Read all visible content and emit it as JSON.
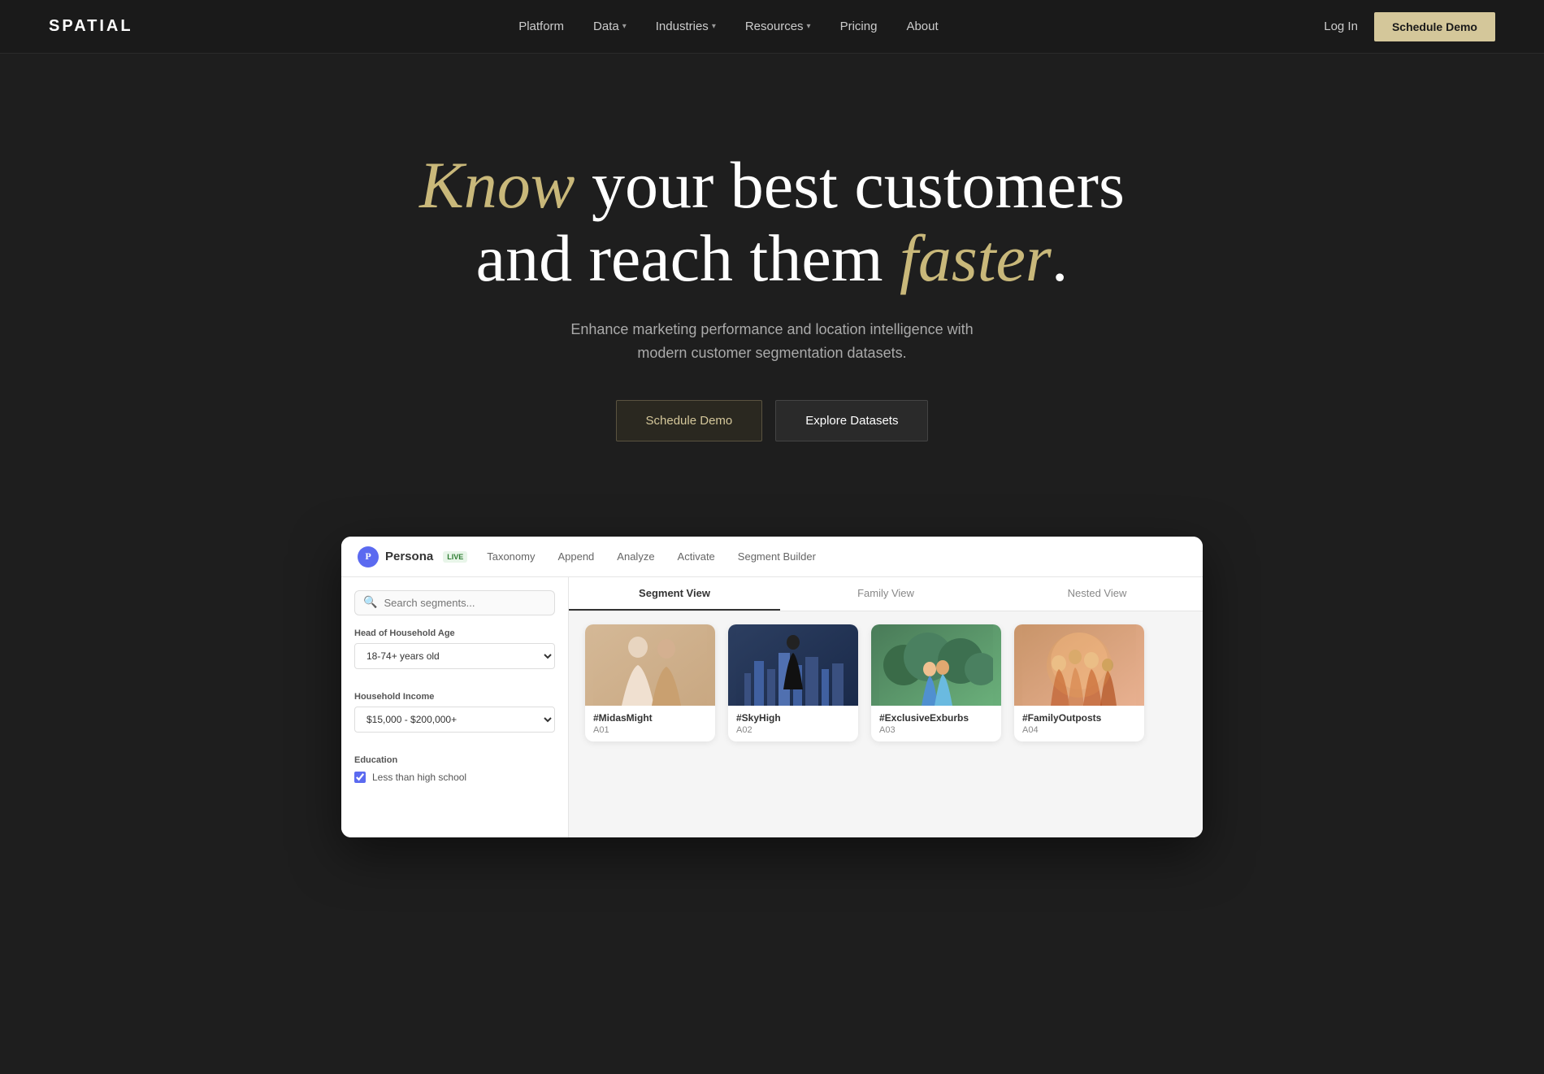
{
  "nav": {
    "logo": "SPATIAL",
    "links": [
      {
        "label": "Platform",
        "has_dropdown": false
      },
      {
        "label": "Data",
        "has_dropdown": true
      },
      {
        "label": "Industries",
        "has_dropdown": true
      },
      {
        "label": "Resources",
        "has_dropdown": true
      },
      {
        "label": "Pricing",
        "has_dropdown": false
      },
      {
        "label": "About",
        "has_dropdown": false
      }
    ],
    "login_label": "Log In",
    "cta_label": "Schedule Demo"
  },
  "hero": {
    "title_start": "your best customers",
    "title_italic_gold": "Know",
    "title_line2_start": "and reach them",
    "title_italic_white": "faster",
    "title_period": ".",
    "subtitle": "Enhance marketing performance and location intelligence with modern customer segmentation datasets.",
    "btn_schedule": "Schedule Demo",
    "btn_explore": "Explore Datasets"
  },
  "demo": {
    "nav_logo": "Persona",
    "nav_live": "LIVE",
    "nav_items": [
      "Taxonomy",
      "Append",
      "Analyze",
      "Activate",
      "Segment Builder"
    ],
    "search_placeholder": "Search segments...",
    "filter_age_label": "Head of Household Age",
    "filter_age_default": "18-74+ years old",
    "filter_income_label": "Household Income",
    "filter_income_default": "$15,000 - $200,000+",
    "filter_education_label": "Education",
    "filter_education_checkbox": "Less than high school",
    "view_tabs": [
      "Segment View",
      "Family View",
      "Nested View"
    ],
    "active_tab": 1,
    "segments": [
      {
        "tag": "#MidasMight",
        "id": "A01",
        "color_from": "#d4b896",
        "color_to": "#c9a882",
        "emoji": "👫"
      },
      {
        "tag": "#SkyHigh",
        "id": "A02",
        "color_from": "#2c3e60",
        "color_to": "#1a2a4a",
        "emoji": "🌆"
      },
      {
        "tag": "#ExclusiveExburbs",
        "id": "A03",
        "color_from": "#4a7c59",
        "color_to": "#6aaf7a",
        "emoji": "🌿"
      },
      {
        "tag": "#FamilyOutposts",
        "id": "A04",
        "color_from": "#c9956a",
        "color_to": "#e8b090",
        "emoji": "🏠"
      }
    ]
  }
}
